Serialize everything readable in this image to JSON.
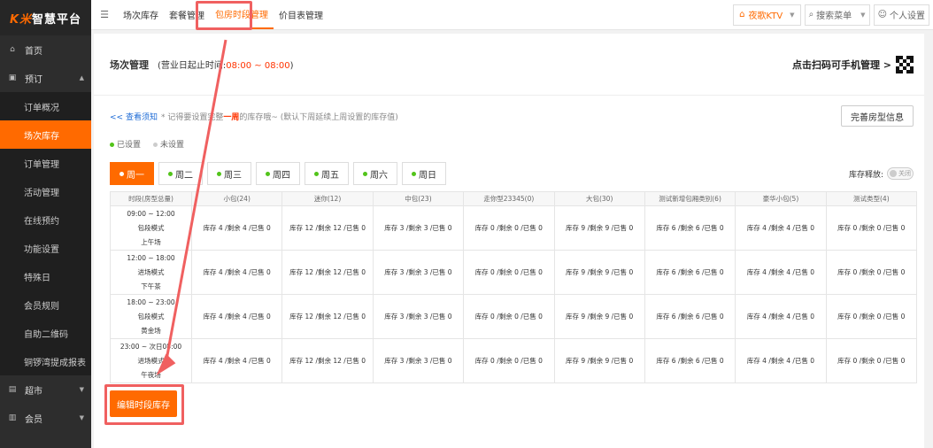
{
  "logo": {
    "k": "K米",
    "rest": "智慧平台"
  },
  "sidebar": {
    "home": "首页",
    "booking": "预订",
    "booking_items": [
      {
        "label": "订单概况",
        "active": false
      },
      {
        "label": "场次库存",
        "active": true
      },
      {
        "label": "订单管理",
        "active": false
      },
      {
        "label": "活动管理",
        "active": false
      },
      {
        "label": "在线预约",
        "active": false
      },
      {
        "label": "功能设置",
        "active": false
      },
      {
        "label": "特殊日",
        "active": false
      },
      {
        "label": "会员规则",
        "active": false
      },
      {
        "label": "自助二维码",
        "active": false
      },
      {
        "label": "铜锣湾提成报表",
        "active": false
      }
    ],
    "market": "超市",
    "member": "会员"
  },
  "topnav": {
    "items": [
      {
        "label": "场次库存",
        "active": false
      },
      {
        "label": "套餐管理",
        "active": false
      },
      {
        "label": "包房时段管理",
        "active": true
      },
      {
        "label": "价目表管理",
        "active": false
      }
    ],
    "store": "夜歌KTV",
    "search": "搜索菜单",
    "user": "个人设置"
  },
  "page": {
    "title": "场次管理",
    "biz_prefix": "(营业日起止时间:",
    "biz_range": "08:00 ~ 08:00",
    "biz_suffix": ")",
    "qr_text": "点击扫码可手机管理 >",
    "notice_link": "<< 查看须知",
    "notice_pre": "* 记得要设置完整",
    "notice_hl": "一周",
    "notice_post": "的库存哦~ (默认下周延续上周设置的库存值)",
    "perfect_btn": "完善房型信息",
    "legend_set": "已设置",
    "legend_unset": "未设置",
    "week_tabs": [
      {
        "label": "周一",
        "active": true
      },
      {
        "label": "周二",
        "active": false
      },
      {
        "label": "周三",
        "active": false
      },
      {
        "label": "周四",
        "active": false
      },
      {
        "label": "周五",
        "active": false
      },
      {
        "label": "周六",
        "active": false
      },
      {
        "label": "周日",
        "active": false
      }
    ],
    "stock_release": "库存释放:",
    "toggle_off": "关闭",
    "edit_btn": "编辑时段库存"
  },
  "table": {
    "headers": [
      "时段(房型总量)",
      "小包(24)",
      "迷你(12)",
      "中包(23)",
      "走你型23345(0)",
      "大包(30)",
      "测试新增包厢类别(6)",
      "豪华小包(5)",
      "测试类型(4)"
    ],
    "rows": [
      {
        "time": "09:00 ~ 12:00",
        "mode": "包段模式",
        "name": "上午场",
        "cells": [
          "库存 4 /剩余 4 /已售 0",
          "库存 12 /剩余 12 /已售 0",
          "库存 3 /剩余 3 /已售 0",
          "库存 0 /剩余 0 /已售 0",
          "库存 9 /剩余 9 /已售 0",
          "库存 6 /剩余 6 /已售 0",
          "库存 4 /剩余 4 /已售 0",
          "库存 0 /剩余 0 /已售 0"
        ]
      },
      {
        "time": "12:00 ~ 18:00",
        "mode": "进场模式",
        "name": "下午茶",
        "cells": [
          "库存 4 /剩余 4 /已售 0",
          "库存 12 /剩余 12 /已售 0",
          "库存 3 /剩余 3 /已售 0",
          "库存 0 /剩余 0 /已售 0",
          "库存 9 /剩余 9 /已售 0",
          "库存 6 /剩余 6 /已售 0",
          "库存 4 /剩余 4 /已售 0",
          "库存 0 /剩余 0 /已售 0"
        ]
      },
      {
        "time": "18:00 ~ 23:00",
        "mode": "包段模式",
        "name": "黄金场",
        "cells": [
          "库存 4 /剩余 4 /已售 0",
          "库存 12 /剩余 12 /已售 0",
          "库存 3 /剩余 3 /已售 0",
          "库存 0 /剩余 0 /已售 0",
          "库存 9 /剩余 9 /已售 0",
          "库存 6 /剩余 6 /已售 0",
          "库存 4 /剩余 4 /已售 0",
          "库存 0 /剩余 0 /已售 0"
        ]
      },
      {
        "time": "23:00 ~ 次日08:00",
        "mode": "进场模式",
        "name": "午夜场",
        "cells": [
          "库存 4 /剩余 4 /已售 0",
          "库存 12 /剩余 12 /已售 0",
          "库存 3 /剩余 3 /已售 0",
          "库存 0 /剩余 0 /已售 0",
          "库存 9 /剩余 9 /已售 0",
          "库存 6 /剩余 6 /已售 0",
          "库存 4 /剩余 4 /已售 0",
          "库存 0 /剩余 0 /已售 0"
        ]
      }
    ]
  },
  "colors": {
    "accent": "#ff6a00",
    "highlight": "#f06060",
    "set": "#52c41a"
  }
}
